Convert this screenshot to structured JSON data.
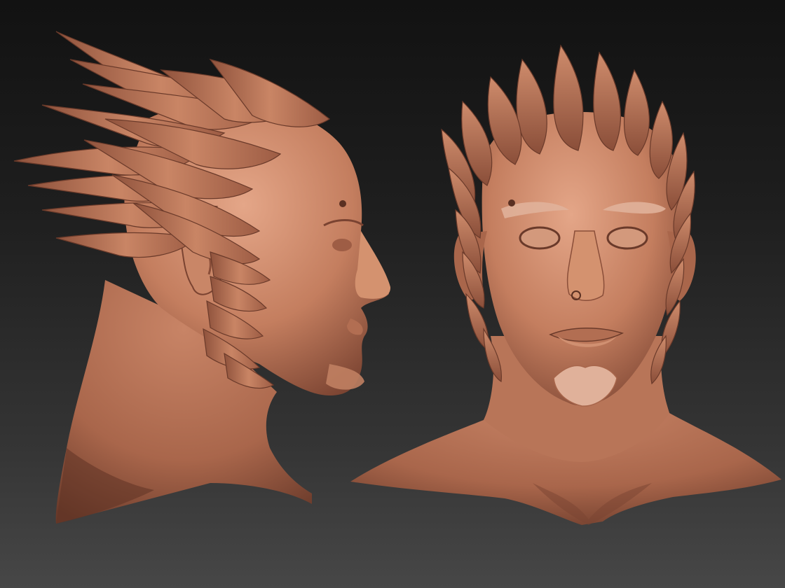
{
  "scene": {
    "views": [
      {
        "id": "side",
        "view": "profile"
      },
      {
        "id": "front",
        "view": "front"
      }
    ],
    "colors": {
      "background_top": "#121212",
      "background_bottom": "#474747",
      "clay": "#c47e5f",
      "clay_highlight": "#e1a284",
      "clay_shadow": "#6a3a2a"
    }
  }
}
